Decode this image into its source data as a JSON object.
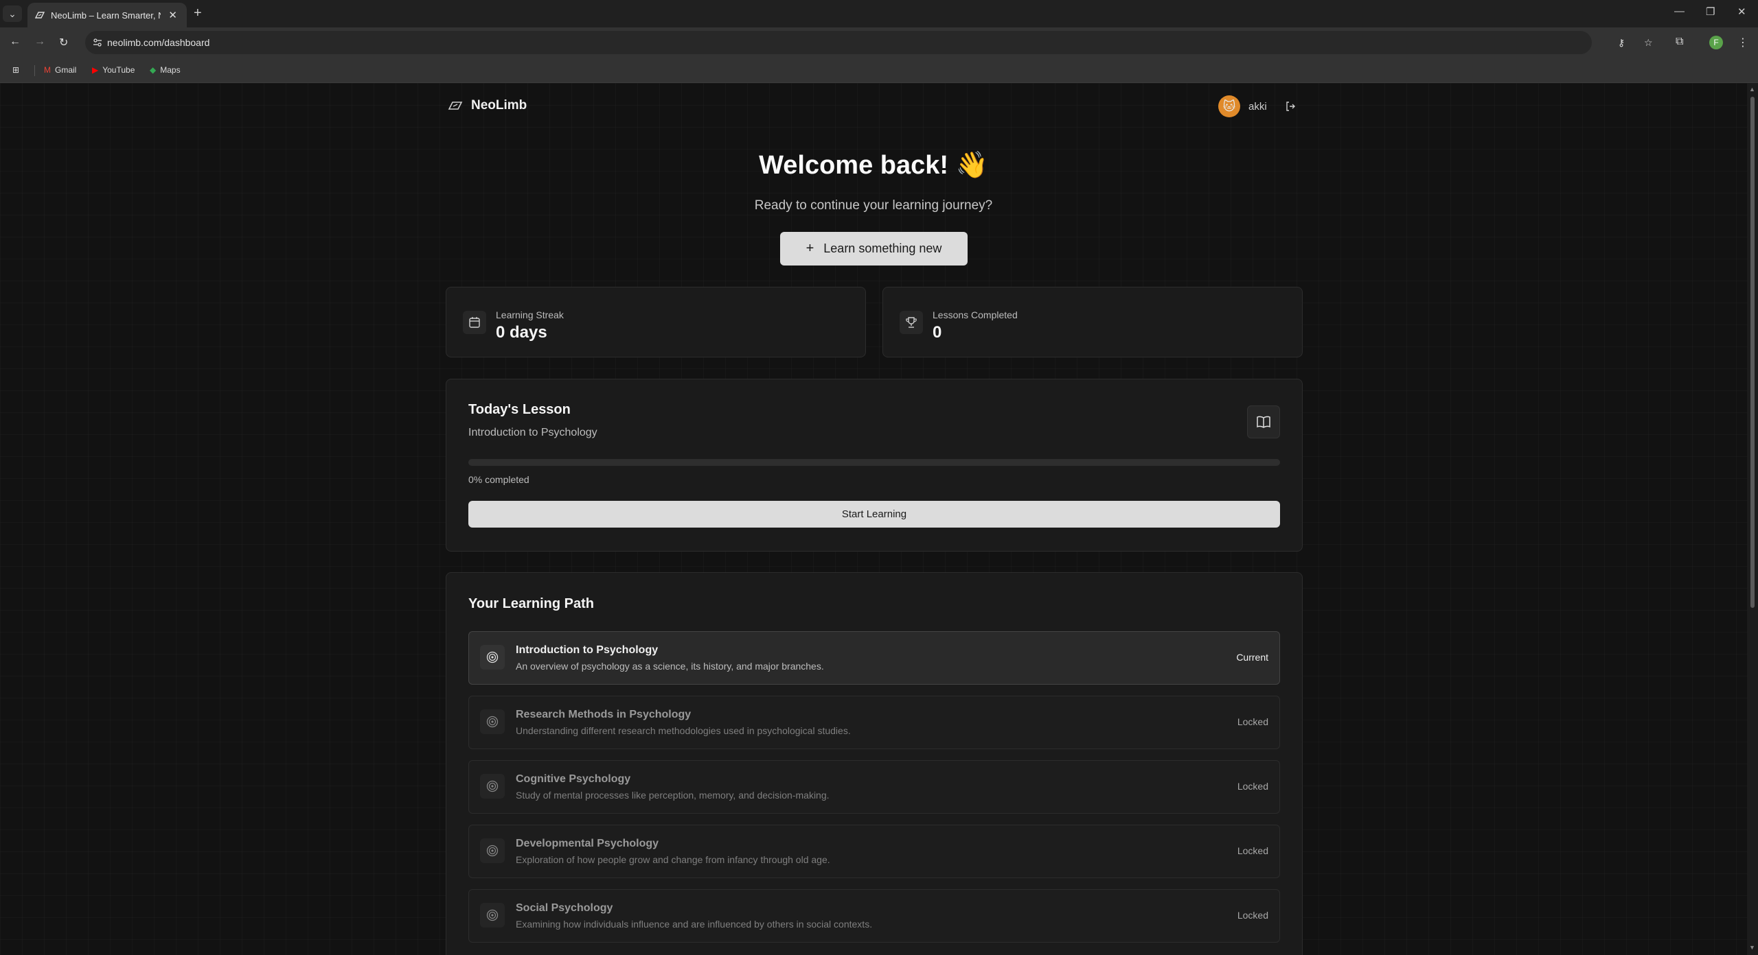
{
  "browser": {
    "tab_title": "NeoLimb – Learn Smarter, Not H",
    "url": "neolimb.com/dashboard",
    "bookmarks": [
      {
        "label": "Gmail"
      },
      {
        "label": "YouTube"
      },
      {
        "label": "Maps"
      }
    ],
    "profile_initial": "F"
  },
  "header": {
    "brand": "NeoLimb",
    "username": "akki"
  },
  "hero": {
    "welcome": "Welcome back! 👋",
    "subtitle": "Ready to continue your learning journey?",
    "learn_button": "Learn something new"
  },
  "stats": {
    "streak_label": "Learning Streak",
    "streak_value": "0 days",
    "lessons_label": "Lessons Completed",
    "lessons_value": "0"
  },
  "today": {
    "title": "Today's Lesson",
    "lesson_name": "Introduction to Psychology",
    "progress_percent": 0,
    "progress_text": "0% completed",
    "start_button": "Start Learning"
  },
  "path": {
    "title": "Your Learning Path",
    "items": [
      {
        "title": "Introduction to Psychology",
        "desc": "An overview of psychology as a science, its history, and major branches.",
        "status": "Current"
      },
      {
        "title": "Research Methods in Psychology",
        "desc": "Understanding different research methodologies used in psychological studies.",
        "status": "Locked"
      },
      {
        "title": "Cognitive Psychology",
        "desc": "Study of mental processes like perception, memory, and decision-making.",
        "status": "Locked"
      },
      {
        "title": "Developmental Psychology",
        "desc": "Exploration of how people grow and change from infancy through old age.",
        "status": "Locked"
      },
      {
        "title": "Social Psychology",
        "desc": "Examining how individuals influence and are influenced by others in social contexts.",
        "status": "Locked"
      }
    ]
  }
}
